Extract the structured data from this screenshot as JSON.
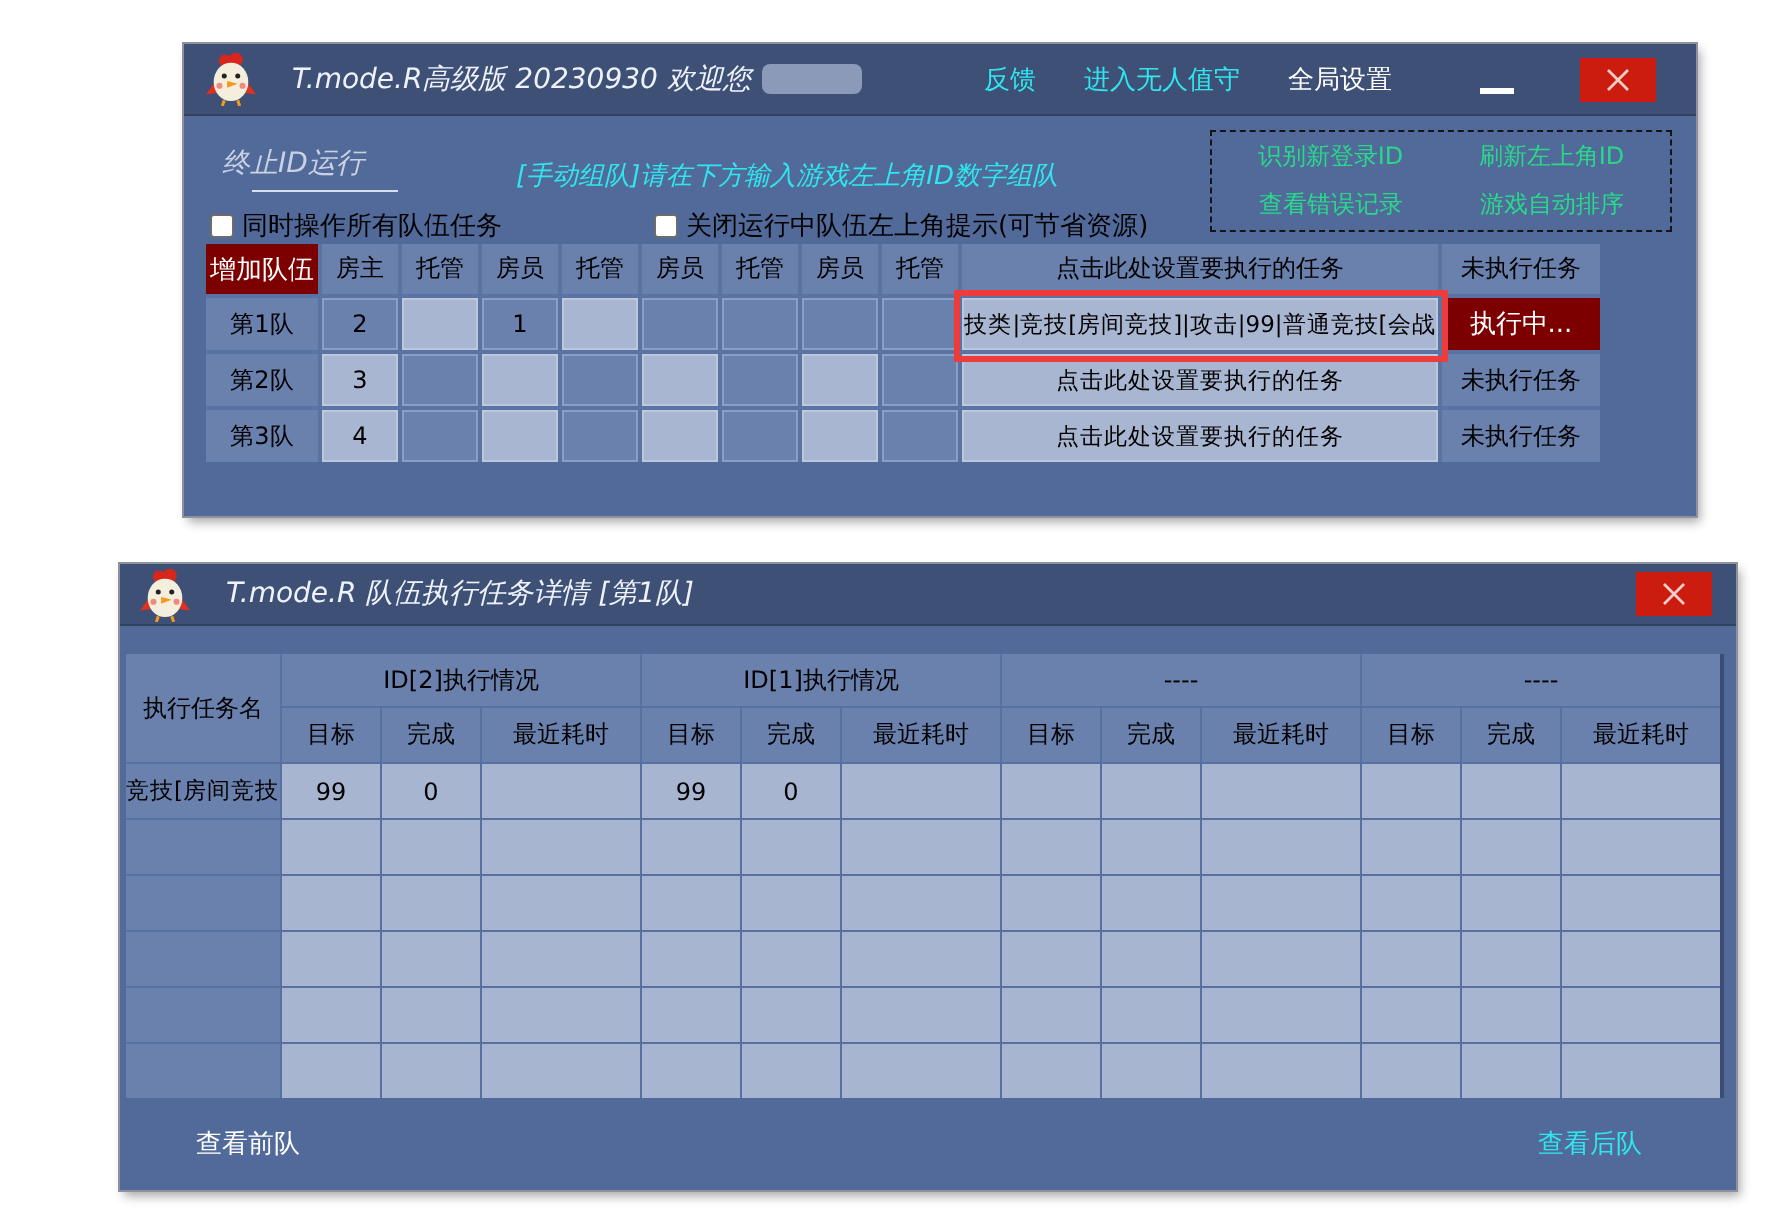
{
  "main_window": {
    "title": "T.mode.R高级版 20230930 欢迎您",
    "title_redacted": true,
    "header_links": [
      {
        "label": "反馈",
        "color": "#2fe6ee"
      },
      {
        "label": "进入无人值守",
        "color": "#2fe6ee"
      },
      {
        "label": "全局设置",
        "color": "#ffffff"
      }
    ],
    "stop_button": "终止ID运行",
    "instruction": "[手动组队]请在下方输入游戏左上角ID数字组队",
    "quick_actions": [
      "识别新登录ID",
      "刷新左上角ID",
      "查看错误记录",
      "游戏自动排序"
    ],
    "options": [
      {
        "label": "同时操作所有队伍任务",
        "checked": false
      },
      {
        "label": "关闭运行中队伍左上角提示(可节省资源)",
        "checked": false
      }
    ],
    "team_table": {
      "add_button": "增加队伍",
      "columns": [
        "房主",
        "托管",
        "房员",
        "托管",
        "房员",
        "托管",
        "房员",
        "托管"
      ],
      "task_column": "点击此处设置要执行的任务",
      "status_column": "未执行任务",
      "rows": [
        {
          "name": "第1队",
          "cells": [
            {
              "value": "2",
              "shaded": true
            },
            {
              "shaded": false
            },
            {
              "value": "1",
              "shaded": true
            },
            {
              "shaded": false
            },
            {
              "shaded": true
            },
            {
              "shaded": true
            },
            {
              "shaded": true
            },
            {
              "shaded": true
            }
          ],
          "task": {
            "text": "技类|竞技[房间竞技]|攻击|99|普通竞技[会战",
            "highlighted": true
          },
          "status": {
            "text": "执行中...",
            "kind": "running"
          }
        },
        {
          "name": "第2队",
          "cells": [
            {
              "value": "3",
              "shaded": false
            },
            {
              "shaded": true
            },
            {
              "shaded": false
            },
            {
              "shaded": true
            },
            {
              "shaded": false
            },
            {
              "shaded": true
            },
            {
              "shaded": false
            },
            {
              "shaded": true
            }
          ],
          "task": {
            "text": "点击此处设置要执行的任务",
            "highlighted": false
          },
          "status": {
            "text": "未执行任务",
            "kind": "idle"
          }
        },
        {
          "name": "第3队",
          "cells": [
            {
              "value": "4",
              "shaded": false
            },
            {
              "shaded": true
            },
            {
              "shaded": false
            },
            {
              "shaded": true
            },
            {
              "shaded": false
            },
            {
              "shaded": true
            },
            {
              "shaded": false
            },
            {
              "shaded": true
            }
          ],
          "task": {
            "text": "点击此处设置要执行的任务",
            "highlighted": false
          },
          "status": {
            "text": "未执行任务",
            "kind": "idle"
          }
        }
      ]
    }
  },
  "detail_window": {
    "title": "T.mode.R 队伍执行任务详情 [第1队]",
    "table": {
      "name_column": "执行任务名",
      "groups": [
        {
          "title": "ID[2]执行情况",
          "columns": [
            "目标",
            "完成",
            "最近耗时"
          ]
        },
        {
          "title": "ID[1]执行情况",
          "columns": [
            "目标",
            "完成",
            "最近耗时"
          ]
        },
        {
          "title": "----",
          "columns": [
            "目标",
            "完成",
            "最近耗时"
          ]
        },
        {
          "title": "----",
          "columns": [
            "目标",
            "完成",
            "最近耗时"
          ]
        }
      ],
      "rows": [
        {
          "kind": "task",
          "name": "竞技[房间竞技",
          "groups": [
            {
              "values": [
                "99",
                "0"
              ]
            },
            {
              "values": [
                "99",
                "0"
              ]
            }
          ]
        },
        {
          "kind": "blank"
        },
        {
          "kind": "blank"
        },
        {
          "kind": "blank"
        },
        {
          "kind": "blank"
        },
        {
          "kind": "blank"
        }
      ]
    },
    "footer_links": [
      {
        "label": "查看前队",
        "color": "#ffffff"
      },
      {
        "label": "查看后队",
        "color": "#2fe6ee"
      }
    ]
  }
}
